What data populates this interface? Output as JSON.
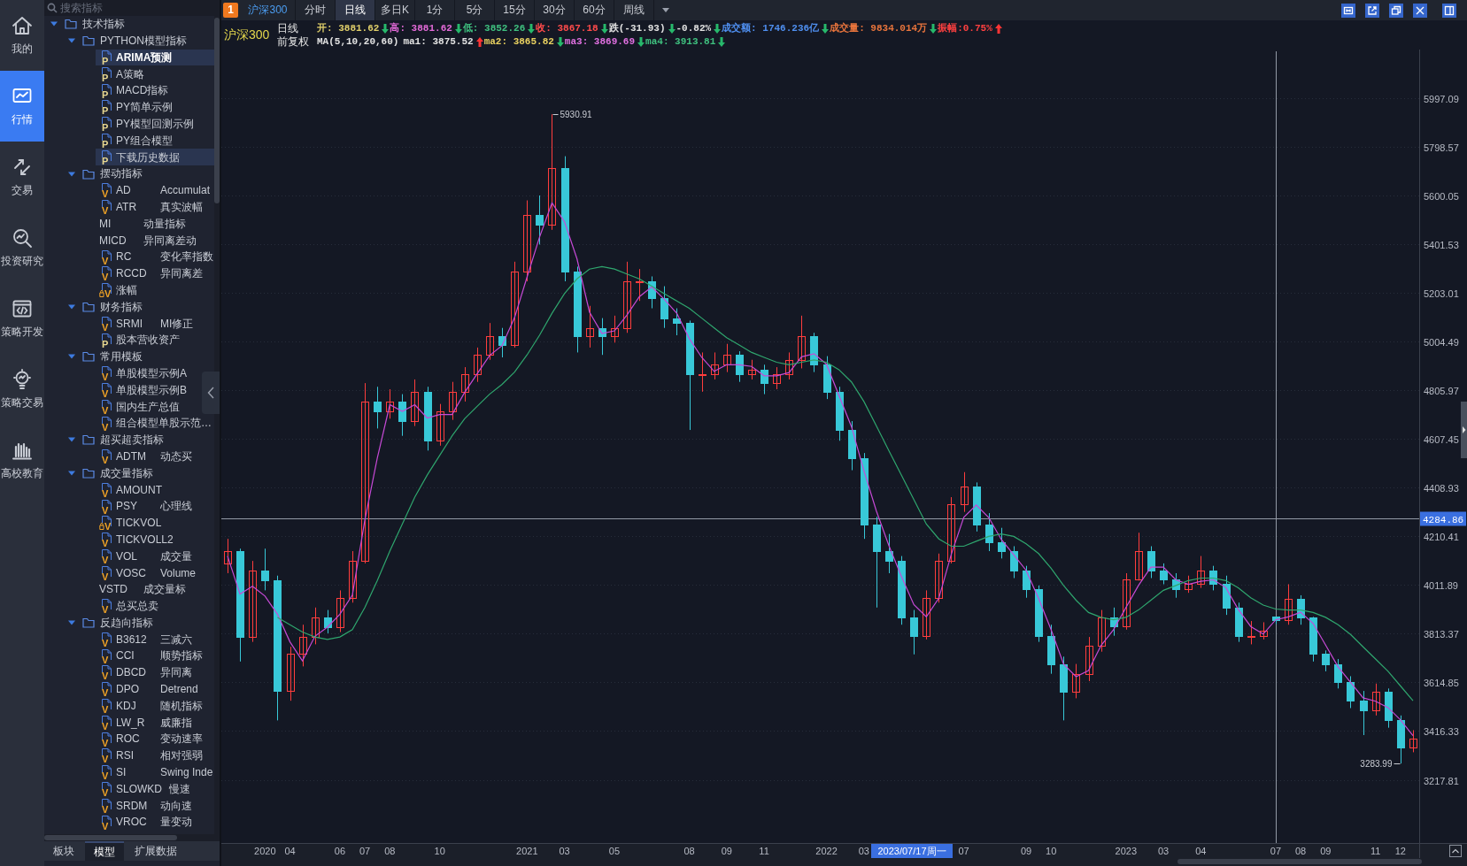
{
  "nav": [
    {
      "label": "我的",
      "selected": false
    },
    {
      "label": "行情",
      "selected": true
    },
    {
      "label": "交易",
      "selected": false
    },
    {
      "label": "投资研究",
      "selected": false
    },
    {
      "label": "策略开发",
      "selected": false
    },
    {
      "label": "策略交易",
      "selected": false
    },
    {
      "label": "高校教育",
      "selected": false
    }
  ],
  "indicator_search": {
    "placeholder": "搜索指标"
  },
  "indicator_tree": [
    {
      "label": "技术指标",
      "expanded": true,
      "children": [
        {
          "label": "PYTHON模型指标",
          "expanded": true,
          "children": [
            {
              "kind": "python",
              "badge": "P",
              "name": "ARIMA预测",
              "selected": true,
              "loaded": true
            },
            {
              "kind": "python",
              "badge": "P",
              "name": "A策略",
              "selected": false,
              "loaded": false
            },
            {
              "kind": "python",
              "badge": "P",
              "name": "MACD指标",
              "selected": false,
              "loaded": false
            },
            {
              "kind": "python",
              "badge": "P",
              "name": "PY简单示例",
              "selected": false,
              "loaded": false
            },
            {
              "kind": "python",
              "badge": "P",
              "name": "PY模型回测示例",
              "selected": false,
              "loaded": false
            },
            {
              "kind": "python",
              "badge": "P",
              "name": "PY组合模型",
              "selected": false,
              "loaded": false
            },
            {
              "kind": "python",
              "badge": "P",
              "name": "下载历史数据",
              "selected": true,
              "loaded": false
            }
          ]
        },
        {
          "label": "摆动指标",
          "expanded": true,
          "children": [
            {
              "kind": "formula",
              "badge": "V",
              "name": "AD",
              "desc": "Accumulat",
              "selected": false,
              "loaded": false
            },
            {
              "kind": "formula",
              "badge": "V",
              "name": "ATR",
              "desc": "真实波幅",
              "selected": false,
              "loaded": false
            },
            {
              "kind": "plain",
              "name": "MI",
              "desc": "动量指标",
              "selected": false,
              "loaded": false
            },
            {
              "kind": "plain",
              "name": "MICD",
              "desc": "异同离差动",
              "selected": false,
              "loaded": false
            },
            {
              "kind": "formula",
              "badge": "V",
              "name": "RC",
              "desc": "变化率指数",
              "selected": false,
              "loaded": false
            },
            {
              "kind": "formula",
              "badge": "V",
              "name": "RCCD",
              "desc": "异同离差",
              "selected": false,
              "loaded": false
            },
            {
              "kind": "locked",
              "badge": "V",
              "name": "涨幅",
              "selected": false,
              "loaded": false
            }
          ]
        },
        {
          "label": "财务指标",
          "expanded": true,
          "children": [
            {
              "kind": "formula",
              "badge": "V",
              "name": "SRMI",
              "desc": "MI修正",
              "selected": false,
              "loaded": false
            },
            {
              "kind": "python",
              "badge": "P",
              "name": "股本营收资产",
              "selected": false,
              "loaded": false
            }
          ]
        },
        {
          "label": "常用模板",
          "expanded": true,
          "children": [
            {
              "kind": "formula",
              "badge": "V",
              "name": "单股模型示例A",
              "selected": false,
              "loaded": false
            },
            {
              "kind": "formula",
              "badge": "V",
              "name": "单股模型示例B",
              "selected": false,
              "loaded": false
            },
            {
              "kind": "formula",
              "badge": "V",
              "name": "国内生产总值",
              "selected": false,
              "loaded": false
            },
            {
              "kind": "formula",
              "badge": "V",
              "name": "组合模型单股示范…",
              "selected": false,
              "loaded": false
            }
          ]
        },
        {
          "label": "超买超卖指标",
          "expanded": true,
          "children": [
            {
              "kind": "formula",
              "badge": "V",
              "name": "ADTM",
              "desc": "动态买",
              "selected": false,
              "loaded": false
            }
          ]
        },
        {
          "label": "成交量指标",
          "expanded": true,
          "children": [
            {
              "kind": "formula",
              "badge": "V",
              "name": "AMOUNT",
              "selected": false,
              "loaded": false
            },
            {
              "kind": "formula",
              "badge": "V",
              "name": "PSY",
              "desc": "心理线",
              "selected": false,
              "loaded": false
            },
            {
              "kind": "locked",
              "badge": "V",
              "name": "TICKVOL",
              "selected": false,
              "loaded": false
            },
            {
              "kind": "formula",
              "badge": "V",
              "name": "TICKVOLL2",
              "selected": false,
              "loaded": false
            },
            {
              "kind": "formula",
              "badge": "V",
              "name": "VOL",
              "desc": "成交量",
              "selected": false,
              "loaded": false
            },
            {
              "kind": "formula",
              "badge": "V",
              "name": "VOSC",
              "desc": "Volume",
              "selected": false,
              "loaded": false
            },
            {
              "kind": "plain",
              "name": "VSTD",
              "desc": "成交量标",
              "selected": false,
              "loaded": false
            },
            {
              "kind": "formula",
              "badge": "V",
              "name": "总买总卖",
              "selected": false,
              "loaded": false
            }
          ]
        },
        {
          "label": "反趋向指标",
          "expanded": true,
          "children": [
            {
              "kind": "formula",
              "badge": "V",
              "name": "B3612",
              "desc": "三减六",
              "selected": false,
              "loaded": false
            },
            {
              "kind": "formula",
              "badge": "V",
              "name": "CCI",
              "desc": "顺势指标",
              "selected": false,
              "loaded": false
            },
            {
              "kind": "formula",
              "badge": "V",
              "name": "DBCD",
              "desc": "异同离",
              "selected": false,
              "loaded": false
            },
            {
              "kind": "formula",
              "badge": "V",
              "name": "DPO",
              "desc": "Detrend",
              "selected": false,
              "loaded": false
            },
            {
              "kind": "formula",
              "badge": "V",
              "name": "KDJ",
              "desc": "随机指标",
              "selected": false,
              "loaded": false
            },
            {
              "kind": "formula",
              "badge": "V",
              "name": "LW_R",
              "desc": "威廉指",
              "selected": false,
              "loaded": false
            },
            {
              "kind": "formula",
              "badge": "V",
              "name": "ROC",
              "desc": "变动速率",
              "selected": false,
              "loaded": false
            },
            {
              "kind": "formula",
              "badge": "V",
              "name": "RSI",
              "desc": "相对强弱",
              "selected": false,
              "loaded": false
            },
            {
              "kind": "formula",
              "badge": "V",
              "name": "SI",
              "desc": "Swing Inde",
              "selected": false,
              "loaded": false
            },
            {
              "kind": "formula",
              "badge": "V",
              "name": "SLOWKD",
              "desc": "慢速",
              "selected": false,
              "loaded": false
            },
            {
              "kind": "formula",
              "badge": "V",
              "name": "SRDM",
              "desc": "动向速",
              "selected": false,
              "loaded": false
            },
            {
              "kind": "formula",
              "badge": "V",
              "name": "VROC",
              "desc": "量变动",
              "selected": false,
              "loaded": false
            }
          ]
        }
      ]
    }
  ],
  "tree_tabs": [
    {
      "label": "板块",
      "selected": false
    },
    {
      "label": "模型",
      "selected": true
    },
    {
      "label": "扩展数据",
      "selected": false
    }
  ],
  "toolbar": {
    "window_number": "1",
    "symbol": "沪深300",
    "periods": [
      {
        "label": "分时",
        "selected": false
      },
      {
        "label": "日线",
        "selected": true
      },
      {
        "label": "多日K",
        "selected": false
      },
      {
        "label": "1分",
        "selected": false
      },
      {
        "label": "5分",
        "selected": false
      },
      {
        "label": "15分",
        "selected": false
      },
      {
        "label": "30分",
        "selected": false
      },
      {
        "label": "60分",
        "selected": false
      },
      {
        "label": "周线",
        "selected": false
      }
    ]
  },
  "quote": {
    "symbol": "沪深300",
    "period": "日线",
    "adjustment": "前复权",
    "fields": [
      {
        "text": "开: 3881.62",
        "color": "#e0cf6a",
        "rising": false
      },
      {
        "text": "高: 3881.62",
        "color": "#e36ad8",
        "rising": false
      },
      {
        "text": "低: 3852.26",
        "color": "#3fc07f",
        "rising": false
      },
      {
        "text": "收: 3867.18",
        "color": "#ff4b4b",
        "rising": false
      },
      {
        "text": "跌(-31.93)",
        "color": "#e2e2e2",
        "rising": false
      },
      {
        "text": "-0.82%",
        "color": "#e2e2e2",
        "rising": false
      },
      {
        "text": "成交额: 1746.236亿",
        "color": "#4f8ff0",
        "rising": false
      },
      {
        "text": "成交量: 9834.014万",
        "color": "#e8743c",
        "rising": false
      },
      {
        "text": "振幅:0.75%",
        "color": "#ff4040",
        "rising": true
      }
    ],
    "ma_label": "MA(5,10,20,60)",
    "ma_fields": [
      {
        "text": "ma1: 3875.52",
        "color": "#e2e2e2",
        "rising": true
      },
      {
        "text": "ma2: 3865.82",
        "color": "#e8d060",
        "rising": false
      },
      {
        "text": "ma3: 3869.69",
        "color": "#e070e0",
        "rising": false
      },
      {
        "text": "ma4: 3913.81",
        "color": "#3fc07f",
        "rising": false
      }
    ]
  },
  "chart": {
    "cursor_date": "2023/07/17周一",
    "chart_data": [
      {
        "type": "candlestick",
        "grid": true,
        "ylim": [
          2960,
          6195
        ],
        "yticks": [
          3217.81,
          3416.33,
          3614.85,
          3813.37,
          4011.89,
          4210.41,
          4408.93,
          4607.45,
          4805.97,
          5004.49,
          5203.01,
          5401.53,
          5600.05,
          5798.57,
          5997.09
        ],
        "categories": [
          null,
          null,
          null,
          "2020",
          null,
          "04",
          null,
          null,
          null,
          "06",
          null,
          "07",
          null,
          "08",
          null,
          null,
          null,
          "10",
          null,
          null,
          null,
          null,
          null,
          null,
          "2021",
          null,
          null,
          "03",
          null,
          null,
          null,
          "05",
          null,
          null,
          null,
          null,
          null,
          "08",
          null,
          null,
          "09",
          null,
          null,
          "11",
          null,
          null,
          null,
          null,
          "2022",
          null,
          null,
          "03",
          null,
          null,
          null,
          null,
          null,
          null,
          null,
          "07",
          null,
          null,
          null,
          null,
          "09",
          null,
          "10",
          null,
          null,
          null,
          null,
          null,
          "2023",
          null,
          null,
          "03",
          null,
          null,
          "04",
          null,
          null,
          null,
          null,
          null,
          "07",
          null,
          "08",
          null,
          "09",
          null,
          null,
          null,
          "11",
          null,
          "12",
          null
        ],
        "ohlc": [
          [
            4100,
            4200,
            4060,
            4150
          ],
          [
            4150,
            4160,
            3700,
            3800
          ],
          [
            3800,
            4110,
            3780,
            4070
          ],
          [
            4070,
            4160,
            3990,
            4030
          ],
          [
            4030,
            4050,
            3460,
            3580
          ],
          [
            3580,
            3760,
            3540,
            3730
          ],
          [
            3730,
            3850,
            3680,
            3800
          ],
          [
            3800,
            3920,
            3770,
            3880
          ],
          [
            3880,
            3910,
            3815,
            3840
          ],
          [
            3840,
            3990,
            3820,
            3960
          ],
          [
            3960,
            4150,
            3940,
            4110
          ],
          [
            4110,
            4835,
            4100,
            4760
          ],
          [
            4760,
            4820,
            4650,
            4720
          ],
          [
            4720,
            4810,
            4690,
            4760
          ],
          [
            4760,
            4790,
            4620,
            4680
          ],
          [
            4680,
            4850,
            4660,
            4800
          ],
          [
            4800,
            4820,
            4560,
            4600
          ],
          [
            4600,
            4750,
            4580,
            4720
          ],
          [
            4720,
            4840,
            4685,
            4800
          ],
          [
            4800,
            4900,
            4760,
            4870
          ],
          [
            4870,
            4980,
            4840,
            4950
          ],
          [
            4950,
            5080,
            4930,
            5025
          ],
          [
            5025,
            5060,
            4940,
            4990
          ],
          [
            4990,
            5330,
            4980,
            5290
          ],
          [
            5290,
            5580,
            5250,
            5520
          ],
          [
            5520,
            5600,
            5400,
            5480
          ],
          [
            5480,
            5930.91,
            5460,
            5710
          ],
          [
            5710,
            5760,
            5250,
            5290
          ],
          [
            5290,
            5310,
            4960,
            5025
          ],
          [
            5025,
            5150,
            4980,
            5060
          ],
          [
            5060,
            5100,
            4950,
            5025
          ],
          [
            5025,
            5110,
            5000,
            5060
          ],
          [
            5060,
            5330,
            5040,
            5250
          ],
          [
            5250,
            5300,
            5170,
            5250
          ],
          [
            5250,
            5270,
            5140,
            5180
          ],
          [
            5180,
            5230,
            5060,
            5100
          ],
          [
            5100,
            5140,
            5030,
            5080
          ],
          [
            5080,
            5090,
            4644,
            4870
          ],
          [
            4870,
            4960,
            4800,
            4870
          ],
          [
            4870,
            4960,
            4850,
            4910
          ],
          [
            4910,
            4995,
            4880,
            4950
          ],
          [
            4950,
            4965,
            4840,
            4870
          ],
          [
            4870,
            4930,
            4850,
            4890
          ],
          [
            4890,
            4910,
            4790,
            4835
          ],
          [
            4835,
            4900,
            4810,
            4870
          ],
          [
            4870,
            4960,
            4850,
            4930
          ],
          [
            4930,
            5110,
            4895,
            5025
          ],
          [
            5025,
            5040,
            4880,
            4910
          ],
          [
            4910,
            4945,
            4770,
            4800
          ],
          [
            4800,
            4820,
            4600,
            4645
          ],
          [
            4645,
            4680,
            4480,
            4530
          ],
          [
            4530,
            4550,
            4200,
            4260
          ],
          [
            4260,
            4290,
            3920,
            4150
          ],
          [
            4150,
            4220,
            4060,
            4110
          ],
          [
            4110,
            4130,
            3850,
            3880
          ],
          [
            3880,
            3910,
            3729,
            3805
          ],
          [
            3805,
            3990,
            3790,
            3960
          ],
          [
            3960,
            4140,
            3940,
            4110
          ],
          [
            4110,
            4370,
            4100,
            4340
          ],
          [
            4340,
            4472,
            4310,
            4415
          ],
          [
            4415,
            4430,
            4230,
            4260
          ],
          [
            4260,
            4305,
            4150,
            4185
          ],
          [
            4185,
            4245,
            4120,
            4150
          ],
          [
            4150,
            4170,
            4040,
            4070
          ],
          [
            4070,
            4090,
            3960,
            3995
          ],
          [
            3995,
            4010,
            3780,
            3805
          ],
          [
            3805,
            3850,
            3650,
            3690
          ],
          [
            3690,
            3720,
            3460,
            3575
          ],
          [
            3575,
            3690,
            3550,
            3650
          ],
          [
            3650,
            3800,
            3620,
            3765
          ],
          [
            3765,
            3910,
            3740,
            3880
          ],
          [
            3880,
            3920,
            3805,
            3845
          ],
          [
            3845,
            4060,
            3830,
            4035
          ],
          [
            4035,
            4225,
            4030,
            4150
          ],
          [
            4150,
            4170,
            4040,
            4070
          ],
          [
            4070,
            4100,
            4015,
            4035
          ],
          [
            4035,
            4060,
            3960,
            3995
          ],
          [
            3995,
            4050,
            3980,
            4015
          ],
          [
            4015,
            4130,
            4000,
            4070
          ],
          [
            4070,
            4090,
            3990,
            4015
          ],
          [
            4015,
            4050,
            3890,
            3920
          ],
          [
            3920,
            3940,
            3780,
            3805
          ],
          [
            3805,
            3865,
            3770,
            3805
          ],
          [
            3805,
            3860,
            3790,
            3825
          ],
          [
            3881.62,
            3881.62,
            3852.26,
            3867.18
          ],
          [
            3867.18,
            4015,
            3850,
            3955
          ],
          [
            3955,
            3970,
            3850,
            3880
          ],
          [
            3880,
            3882,
            3700,
            3730
          ],
          [
            3730,
            3745,
            3660,
            3690
          ],
          [
            3690,
            3710,
            3590,
            3615
          ],
          [
            3615,
            3640,
            3510,
            3540
          ],
          [
            3540,
            3580,
            3400,
            3500
          ],
          [
            3500,
            3610,
            3480,
            3575
          ],
          [
            3575,
            3590,
            3430,
            3460
          ],
          [
            3460,
            3480,
            3283.99,
            3350
          ],
          [
            3350,
            3420,
            3330,
            3385
          ]
        ],
        "series": [
          {
            "type": "line",
            "color": "#c64ad6",
            "values": [
              4130,
              3975,
              4007,
              3967,
              3893,
              3780,
              3703,
              3803,
              3840,
              3893,
              3970,
              4277,
              4530,
              4747,
              4720,
              4747,
              4693,
              4707,
              4707,
              4797,
              4873,
              4948,
              4988,
              5102,
              5267,
              5430,
              5570,
              5493,
              5342,
              5125,
              5037,
              5048,
              5112,
              5187,
              5227,
              5177,
              5120,
              5017,
              4940,
              4883,
              4910,
              4910,
              4903,
              4865,
              4865,
              4878,
              4942,
              4955,
              4912,
              4785,
              4658,
              4478,
              4313,
              4173,
              4047,
              3932,
              3882,
              3958,
              4137,
              4288,
              4338,
              4287,
              4198,
              4135,
              4072,
              3957,
              3830,
              3690,
              3638,
              3663,
              3765,
              3830,
              3920,
              4010,
              4085,
              4085,
              4033,
              4015,
              4027,
              4033,
              4002,
              3913,
              3843,
              3812,
              3870,
              3882,
              3901,
              3855,
              3767,
              3678,
              3615,
              3552,
              3538,
              3512,
              3462,
              3398
            ]
          },
          {
            "type": "line",
            "color": "#2fa66e",
            "values": [
              null,
              null,
              null,
              null,
              3880,
              3850,
              3820,
              3800,
              3790,
              3800,
              3830,
              3920,
              4030,
              4150,
              4260,
              4370,
              4460,
              4540,
              4620,
              4690,
              4740,
              4790,
              4830,
              4880,
              4950,
              5030,
              5120,
              5200,
              5260,
              5300,
              5310,
              5300,
              5280,
              5260,
              5230,
              5200,
              5170,
              5140,
              5100,
              5060,
              5020,
              4990,
              4960,
              4940,
              4920,
              4910,
              4920,
              4930,
              4920,
              4890,
              4840,
              4760,
              4660,
              4560,
              4460,
              4360,
              4260,
              4200,
              4170,
              4170,
              4190,
              4210,
              4220,
              4210,
              4180,
              4140,
              4080,
              4010,
              3950,
              3900,
              3880,
              3870,
              3880,
              3910,
              3950,
              3990,
              4010,
              4030,
              4040,
              4040,
              4030,
              4000,
              3960,
              3930,
              3914,
              3910,
              3910,
              3900,
              3880,
              3850,
              3810,
              3760,
              3710,
              3660,
              3600,
              3540
            ]
          }
        ],
        "ref_lines": [
          {
            "axis": "y",
            "value": 4284.86,
            "label": "4284.86"
          }
        ],
        "annotations": [
          "5930.91",
          "3283.99"
        ]
      }
    ]
  }
}
